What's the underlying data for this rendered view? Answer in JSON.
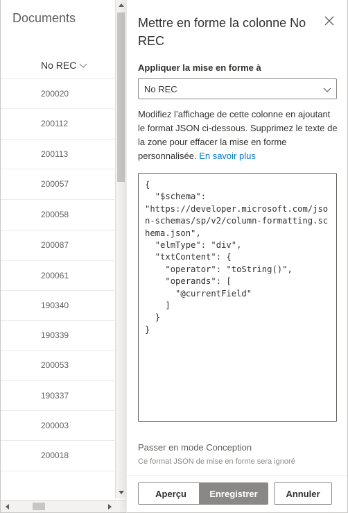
{
  "list": {
    "title": "Documents",
    "column_header": "No REC",
    "rows": [
      {
        "value": "200020",
        "h": 43
      },
      {
        "value": "200112",
        "h": 44
      },
      {
        "value": "200113",
        "h": 43
      },
      {
        "value": "200057",
        "h": 44
      },
      {
        "value": "200058",
        "h": 44
      },
      {
        "value": "200087",
        "h": 44
      },
      {
        "value": "200061",
        "h": 43
      },
      {
        "value": "190340",
        "h": 43
      },
      {
        "value": "190339",
        "h": 43
      },
      {
        "value": "200053",
        "h": 44
      },
      {
        "value": "190337",
        "h": 43
      },
      {
        "value": "200003",
        "h": 43
      },
      {
        "value": "200018",
        "h": 44
      }
    ]
  },
  "panel": {
    "title": "Mettre en forme la colonne No REC",
    "apply_label": "Appliquer la mise en forme à",
    "dropdown_value": "No REC",
    "description": "Modifiez l’affichage de cette colonne en ajoutant le format JSON ci-dessous. Supprimez le texte de la zone pour effacer la mise en forme personnalisée.",
    "learn_more": "En savoir plus",
    "json_text": "{\n  \"$schema\":\n\"https://developer.microsoft.com/json-schemas/sp/v2/column-formatting.schema.json\",\n  \"elmType\": \"div\",\n  \"txtContent\": {\n    \"operator\": \"toString()\",\n    \"operands\": [\n      \"@currentField\"\n    ]\n  }\n}",
    "design_mode_link": "Passer en mode Conception",
    "ignored_note": "Ce format JSON de mise en forme sera ignoré",
    "buttons": {
      "preview": "Aperçu",
      "save": "Enregistrer",
      "cancel": "Annuler"
    }
  },
  "icons": {
    "sort": "chevron-down-icon",
    "close": "close-icon",
    "dropdown": "chevron-down-icon"
  },
  "colors": {
    "accent_link": "#0078d4",
    "save_button_bg": "#8a8886",
    "text_primary": "#323130",
    "text_secondary": "#605e5c"
  }
}
